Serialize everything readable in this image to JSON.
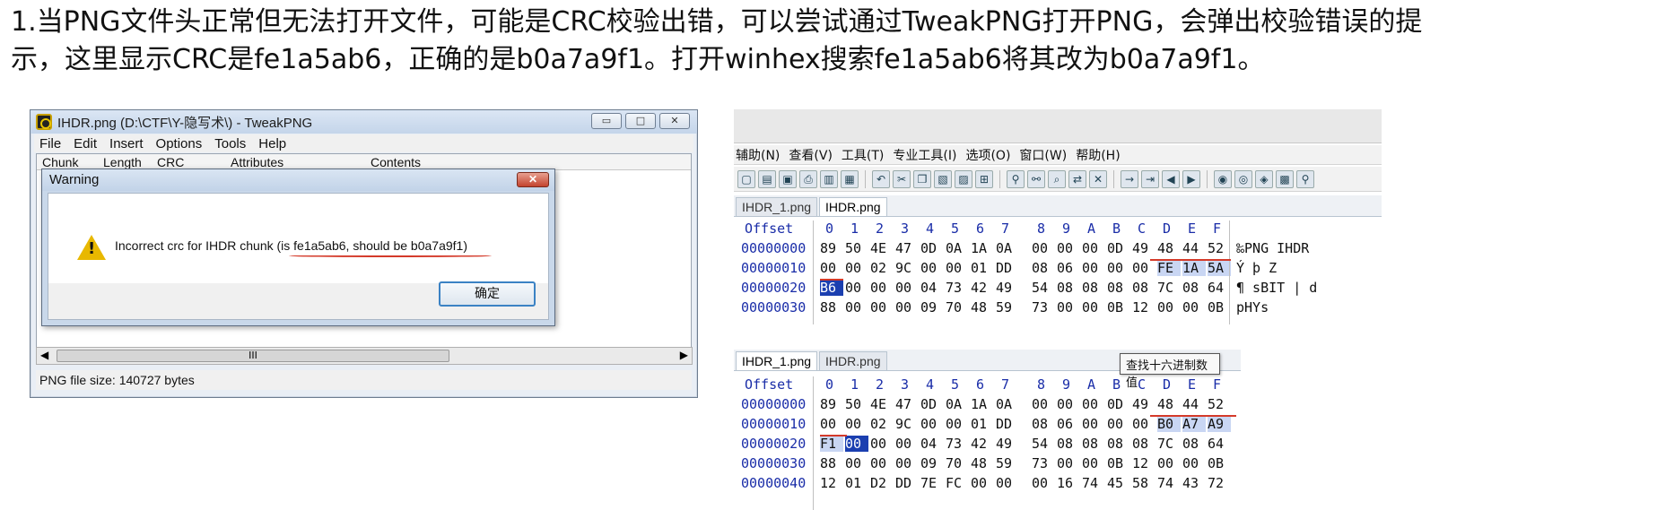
{
  "intro": {
    "line1": "1.当PNG文件头正常但无法打开文件，可能是CRC校验出错，可以尝试通过TweakPNG打开PNG，会弹出校验错误的提",
    "line2": "示，这里显示CRC是fe1a5ab6，正确的是b0a7a9f1。打开winhex搜索fe1a5ab6将其改为b0a7a9f1。"
  },
  "tweakpng": {
    "title": "IHDR.png (D:\\CTF\\Y-隐写术\\) - TweakPNG",
    "menu": [
      "File",
      "Edit",
      "Insert",
      "Options",
      "Tools",
      "Help"
    ],
    "columns": [
      "Chunk",
      "Length",
      "CRC",
      "Attributes",
      "Contents"
    ],
    "status": "PNG file size: 140727 bytes",
    "scroll_grip": "III",
    "warning": {
      "title": "Warning",
      "message": "Incorrect crc for IHDR chunk (is fe1a5ab6, should be b0a7a9f1)",
      "ok_label": "确定"
    }
  },
  "hex_before": {
    "menu": [
      "辅助(N)",
      "查看(V)",
      "工具(T)",
      "专业工具(I)",
      "选项(O)",
      "窗口(W)",
      "帮助(H)"
    ],
    "tabs": [
      "IHDR_1.png",
      "IHDR.png"
    ],
    "active_tab": 1,
    "header": [
      "Offset",
      "0",
      "1",
      "2",
      "3",
      "4",
      "5",
      "6",
      "7",
      "8",
      "9",
      "A",
      "B",
      "C",
      "D",
      "E",
      "F"
    ],
    "rows": [
      {
        "offset": "00000000",
        "bytes": [
          "89",
          "50",
          "4E",
          "47",
          "0D",
          "0A",
          "1A",
          "0A",
          "00",
          "00",
          "00",
          "0D",
          "49",
          "48",
          "44",
          "52"
        ],
        "ascii": "‰PNG        IHDR"
      },
      {
        "offset": "00000010",
        "bytes": [
          "00",
          "00",
          "02",
          "9C",
          "00",
          "00",
          "01",
          "DD",
          "08",
          "06",
          "00",
          "00",
          "00",
          "FE",
          "1A",
          "5A"
        ],
        "ascii": "   Ý       þ Z"
      },
      {
        "offset": "00000020",
        "bytes": [
          "B6",
          "00",
          "00",
          "00",
          "04",
          "73",
          "42",
          "49",
          "54",
          "08",
          "08",
          "08",
          "08",
          "7C",
          "08",
          "64"
        ],
        "ascii": "¶    sBIT    | d"
      },
      {
        "offset": "00000030",
        "bytes": [
          "88",
          "00",
          "00",
          "00",
          "09",
          "70",
          "48",
          "59",
          "73",
          "00",
          "00",
          "0B",
          "12",
          "00",
          "00",
          "0B"
        ],
        "ascii": "     pHYs"
      }
    ]
  },
  "hex_after": {
    "tabs": [
      "IHDR_1.png",
      "IHDR.png"
    ],
    "active_tab": 0,
    "tooltip": "查找十六进制数值",
    "header": [
      "Offset",
      "0",
      "1",
      "2",
      "3",
      "4",
      "5",
      "6",
      "7",
      "8",
      "9",
      "A",
      "B",
      "C",
      "D",
      "E",
      "F"
    ],
    "rows": [
      {
        "offset": "00000000",
        "bytes": [
          "89",
          "50",
          "4E",
          "47",
          "0D",
          "0A",
          "1A",
          "0A",
          "00",
          "00",
          "00",
          "0D",
          "49",
          "48",
          "44",
          "52"
        ]
      },
      {
        "offset": "00000010",
        "bytes": [
          "00",
          "00",
          "02",
          "9C",
          "00",
          "00",
          "01",
          "DD",
          "08",
          "06",
          "00",
          "00",
          "00",
          "B0",
          "A7",
          "A9"
        ]
      },
      {
        "offset": "00000020",
        "bytes": [
          "F1",
          "00",
          "00",
          "00",
          "04",
          "73",
          "42",
          "49",
          "54",
          "08",
          "08",
          "08",
          "08",
          "7C",
          "08",
          "64"
        ]
      },
      {
        "offset": "00000030",
        "bytes": [
          "88",
          "00",
          "00",
          "00",
          "09",
          "70",
          "48",
          "59",
          "73",
          "00",
          "00",
          "0B",
          "12",
          "00",
          "00",
          "0B"
        ]
      },
      {
        "offset": "00000040",
        "bytes": [
          "12",
          "01",
          "D2",
          "DD",
          "7E",
          "FC",
          "00",
          "00",
          "00",
          "16",
          "74",
          "45",
          "58",
          "74",
          "43",
          "72"
        ]
      }
    ]
  }
}
